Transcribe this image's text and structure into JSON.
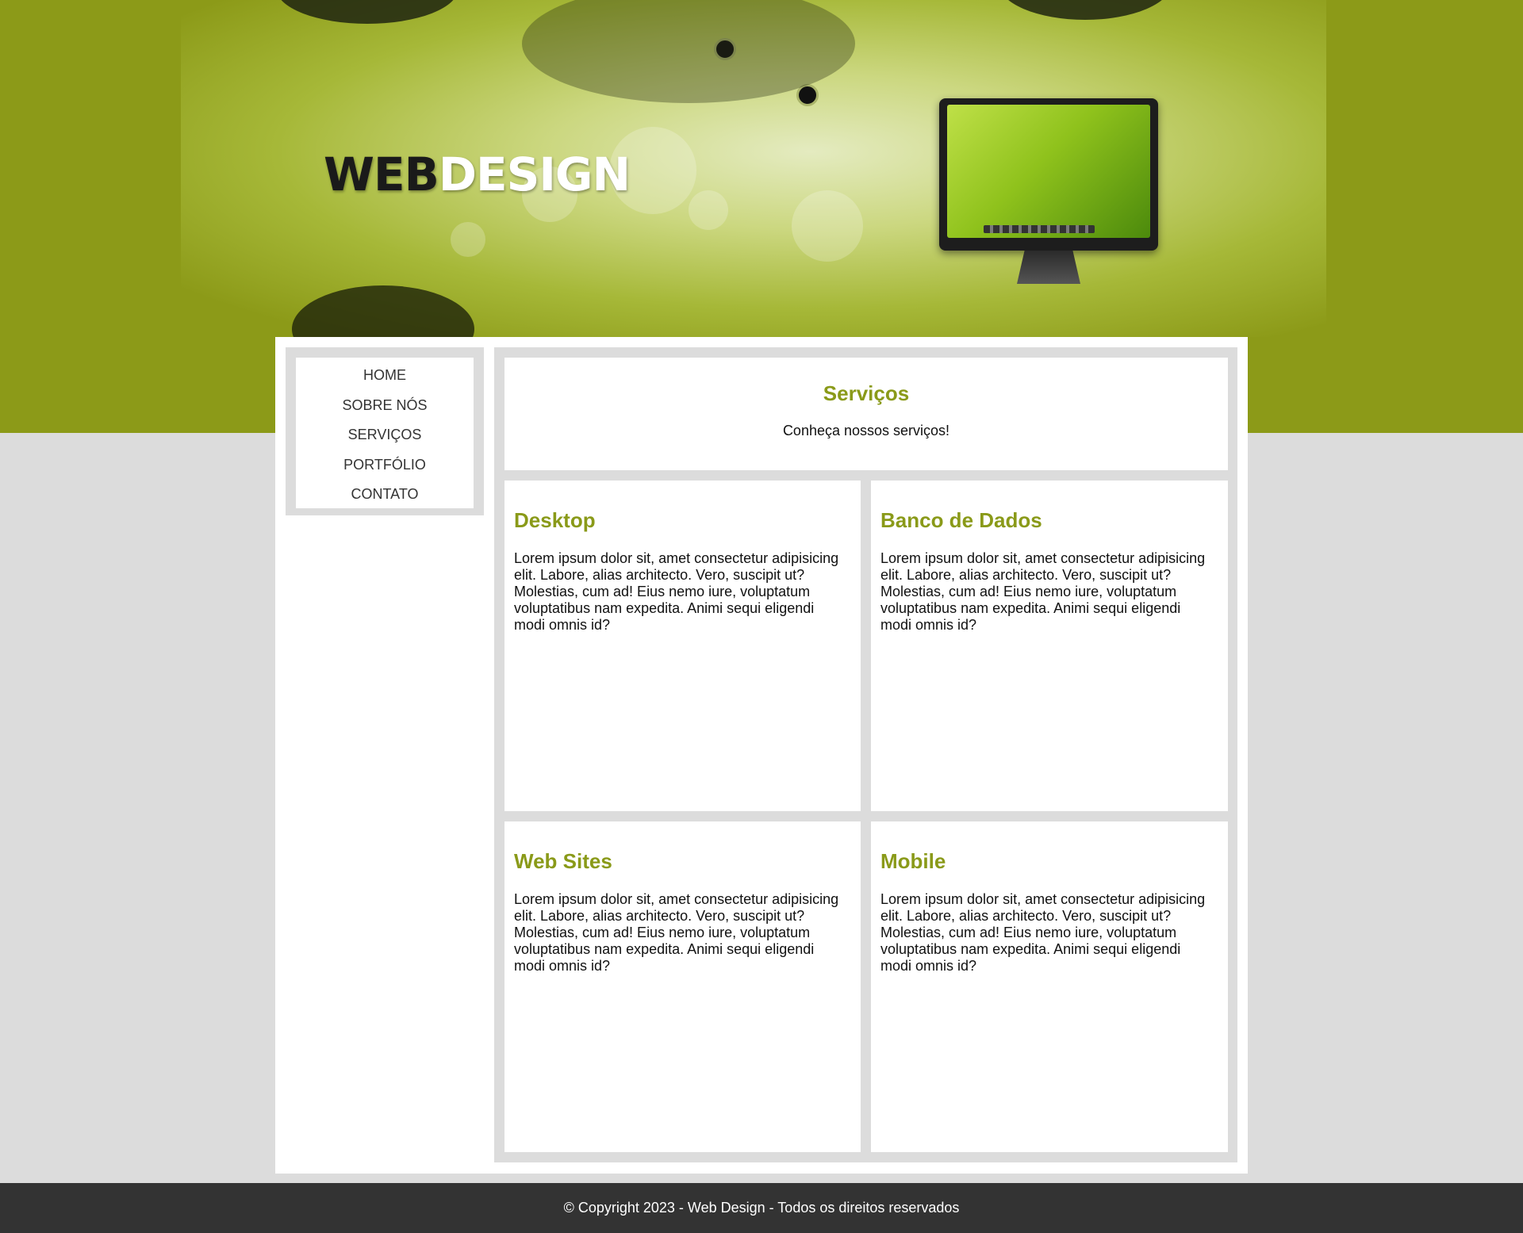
{
  "header": {
    "logo_part1": "WEB",
    "logo_part2": "DESIGN",
    "brand_color": "#8c9a18"
  },
  "nav": {
    "items": [
      {
        "label": "HOME"
      },
      {
        "label": "SOBRE NÓS"
      },
      {
        "label": "SERVIÇOS"
      },
      {
        "label": "PORTFÓLIO"
      },
      {
        "label": "CONTATO"
      }
    ]
  },
  "intro": {
    "title": "Serviços",
    "subtitle": "Conheça nossos serviços!"
  },
  "services": [
    {
      "title": "Desktop",
      "text": "Lorem ipsum dolor sit, amet consectetur adipisicing elit. Labore, alias architecto. Vero, suscipit ut? Molestias, cum ad! Eius nemo iure, voluptatum voluptatibus nam expedita. Animi sequi eligendi modi omnis id?"
    },
    {
      "title": "Banco de Dados",
      "text": "Lorem ipsum dolor sit, amet consectetur adipisicing elit. Labore, alias architecto. Vero, suscipit ut? Molestias, cum ad! Eius nemo iure, voluptatum voluptatibus nam expedita. Animi sequi eligendi modi omnis id?"
    },
    {
      "title": "Web Sites",
      "text": "Lorem ipsum dolor sit, amet consectetur adipisicing elit. Labore, alias architecto. Vero, suscipit ut? Molestias, cum ad! Eius nemo iure, voluptatum voluptatibus nam expedita. Animi sequi eligendi modi omnis id?"
    },
    {
      "title": "Mobile",
      "text": "Lorem ipsum dolor sit, amet consectetur adipisicing elit. Labore, alias architecto. Vero, suscipit ut? Molestias, cum ad! Eius nemo iure, voluptatum voluptatibus nam expedita. Animi sequi eligendi modi omnis id?"
    }
  ],
  "footer": {
    "text": "© Copyright 2023 - Web Design - Todos os direitos reservados"
  },
  "colors": {
    "accent": "#8a9a19",
    "page_bg": "#dcdcdc",
    "footer_bg": "#333333"
  }
}
